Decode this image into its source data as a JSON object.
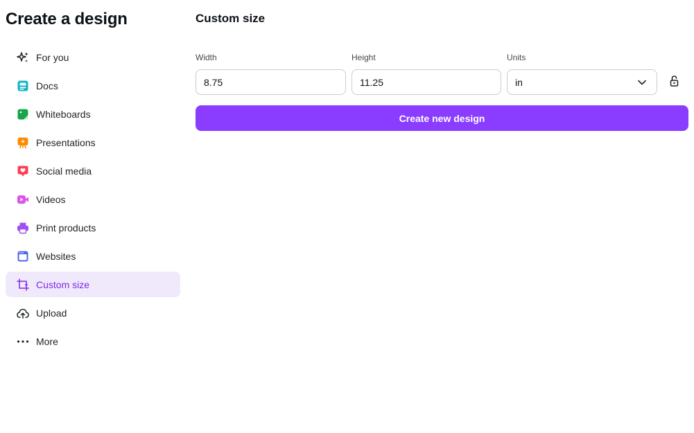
{
  "sidebar": {
    "title": "Create a design",
    "items": [
      {
        "label": "For you",
        "icon": "sparkles-icon",
        "color": "#1e2327"
      },
      {
        "label": "Docs",
        "icon": "docs-icon",
        "color": "#13b6c8"
      },
      {
        "label": "Whiteboards",
        "icon": "whiteboard-icon",
        "color": "#1aa44a"
      },
      {
        "label": "Presentations",
        "icon": "presentation-icon",
        "color": "#ff8b00"
      },
      {
        "label": "Social media",
        "icon": "heart-icon",
        "color": "#ff3b55"
      },
      {
        "label": "Videos",
        "icon": "video-icon",
        "color": "#d955e8"
      },
      {
        "label": "Print products",
        "icon": "printer-icon",
        "color": "#a150f0"
      },
      {
        "label": "Websites",
        "icon": "website-icon",
        "color": "#5263ef"
      },
      {
        "label": "Custom size",
        "icon": "custom-size-icon",
        "color": "#7d2ae8",
        "active": true
      },
      {
        "label": "Upload",
        "icon": "cloud-upload-icon",
        "color": "#1e2327"
      },
      {
        "label": "More",
        "icon": "more-dots-icon",
        "color": "#1e2327"
      }
    ]
  },
  "main": {
    "heading": "Custom size",
    "width": {
      "label": "Width",
      "value": "8.75"
    },
    "height": {
      "label": "Height",
      "value": "11.25"
    },
    "units": {
      "label": "Units",
      "value": "in"
    },
    "create_label": "Create new design",
    "accent": "#8b3dff"
  }
}
